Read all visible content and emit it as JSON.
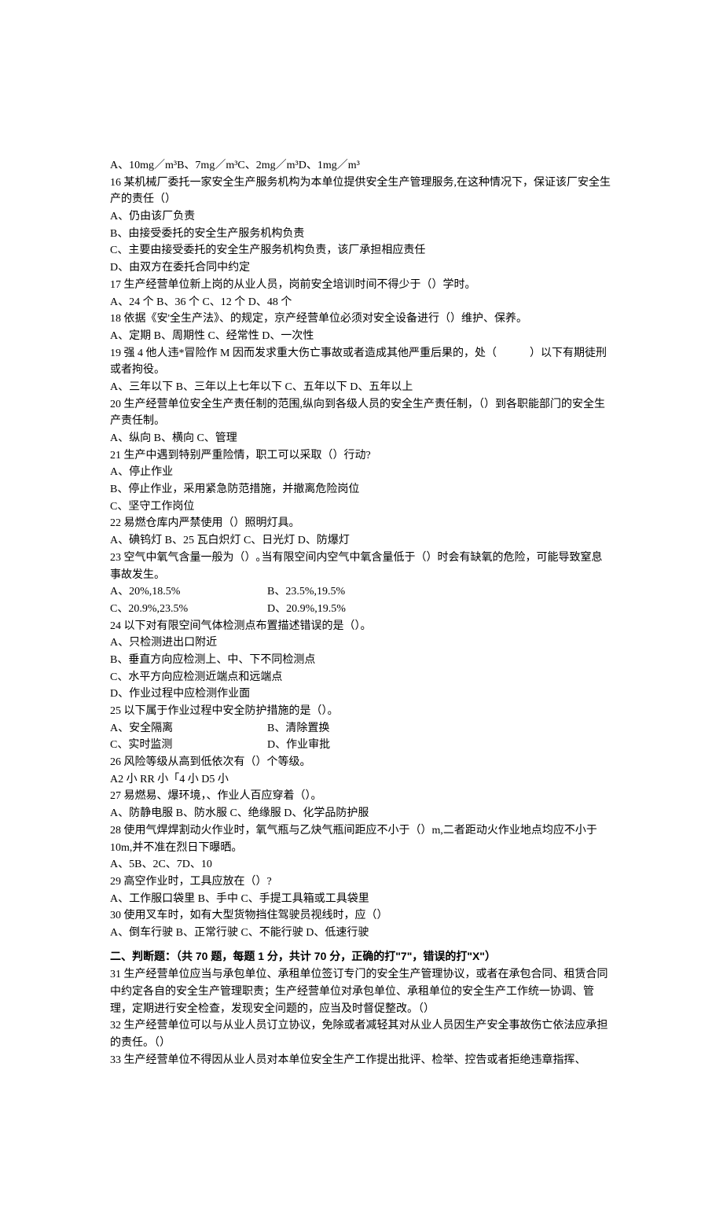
{
  "lines": [
    "A、10mg／m³B、7mg／m³C、2mg／m³D、1mg／m³",
    "16 某机械厂委托一家安全生产服务机构为本单位提供安全生产管理服务,在这种情况下，保证该厂安全生产的责任（）",
    "A、仍由该厂负责",
    "B、由接受委托的安全生产服务机构负责",
    "C、主要由接受委托的安全生产服务机构负责，该厂承担相应责任",
    "D、由双方在委托合同中约定",
    "17 生产经营单位新上岗的从业人员，岗前安全培训时间不得少于（）学时。",
    "A、24 个 B、36 个 C、12 个 D、48 个",
    "18 依据《安'全生产法》、的规定，京产经营单位必须对安全设备进行（）维护、保养。",
    "A、定期 B、周期性 C、经常性 D、一次性",
    "19 强 4 他人违*冒险作 M 因而发求重大伤亡事故或者造成其他严重后果的，处（　　　）以下有期徒刑或者拘役。",
    "A、三年以下 B、三年以上七年以下 C、五年以下 D、五年以上",
    "20 生产经营单位安全生产责任制的范围,纵向到各级人员的安全生产责任制，（）到各职能部门的安全生产责任制。",
    "A、纵向 B、横向 C、管理",
    "21 生产中遇到特别严重险情，职工可以采取（）行动?",
    "A、停止作业",
    "B、停止作业，采用紧急防范措施，并撤离危险岗位",
    "C、坚守工作岗位",
    "22 易燃仓库内严禁使用（）照明灯具。",
    "A、碘钨灯 B、25 瓦白炽灯 C、日光灯 D、防爆灯",
    "23 空气中氧气含量一般为（）｡当有限空间内空气中氧含量低于（）时会有缺氧的危险，可能导致窒息事故发生。"
  ],
  "q23_opts": {
    "a": "A、20%,18.5%",
    "b": "B、23.5%,19.5%",
    "c": "C、20.9%,23.5%",
    "d": "D、20.9%,19.5%"
  },
  "lines2": [
    "24 以下对有限空间气体检测点布置描述错误的是（）。",
    "A、只检测进出口附近",
    "B、垂直方向应检测上、中、下不同检测点",
    "C、水平方向应检测近端点和远端点",
    "D、作业过程中应检测作业面",
    "25 以下属于作业过程中安全防护措施的是（）。"
  ],
  "q25_opts": {
    "a": "A、安全隔离",
    "b": "B、清除置换",
    "c": "C、实时监测",
    "d": "D、作业审批"
  },
  "lines3": [
    "26 风险等级从高到低依次有（）个等级。",
    "A2 小 RR 小「4 小 D5 小",
    "27 易燃易、爆环境，、作业人百应穿着（）。",
    "A、防静电服 B、防水服 C、绝缘服 D、化学品防护服",
    "28 使用气焊焊割动火作业时，氧气瓶与乙炔气瓶间距应不小于（）m,二者距动火作业地点均应不小于 10m,并不准在烈日下曝晒。",
    "A、5B、2C、7D、10",
    "29 高空作业时，工具应放在（）?",
    "A、工作服口袋里 B、手中 C、手提工具箱或工具袋里",
    "30 使用叉车时，如有大型货物挡住驾驶员视线时，应（）",
    "A、倒车行驶 B、正常行驶 C、不能行驶 D、低速行驶"
  ],
  "section2_title": "二、判断题：（共 70 题，每题 1 分，共计 70 分，正确的打\"7\"，错误的打\"X\"）",
  "lines4": [
    "31 生产经营单位应当与承包单位、承租单位签订专门的安全生产管理协议，或者在承包合同、租赁合同中约定各自的安全生产管理职责；生产经营单位对承包单位、承租单位的安全生产工作统一协调、管理，定期进行安全检查，发现安全问题的，应当及时督促整改。（）",
    "32 生产经营单位可以与从业人员订立协议，免除或者减轻其对从业人员因生产安全事故伤亡依法应承担的责任。（）",
    "33 生产经营单位不得因从业人员对本单位安全生产工作提出批评、检举、控告或者拒绝违章指挥、"
  ]
}
